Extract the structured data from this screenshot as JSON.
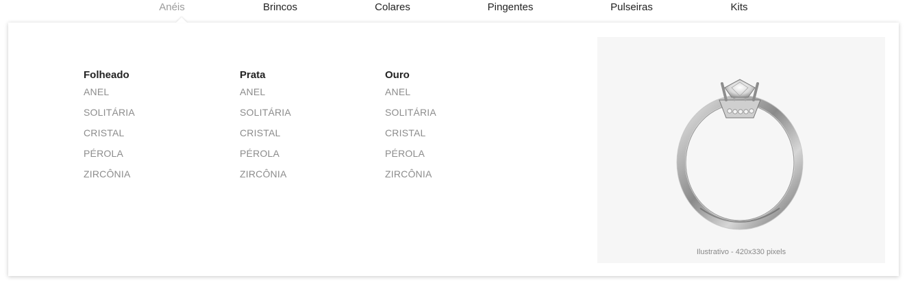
{
  "nav": {
    "items": [
      {
        "label": "Anéis",
        "active": true
      },
      {
        "label": "Brincos",
        "active": false
      },
      {
        "label": "Colares",
        "active": false
      },
      {
        "label": "Pingentes",
        "active": false
      },
      {
        "label": "Pulseiras",
        "active": false
      },
      {
        "label": "Kits",
        "active": false
      }
    ]
  },
  "menu": {
    "columns": [
      {
        "heading": "Folheado",
        "links": [
          "ANEL",
          "SOLITÁRIA",
          "CRISTAL",
          "PÉROLA",
          "ZIRCÔNIA"
        ]
      },
      {
        "heading": "Prata",
        "links": [
          "ANEL",
          "SOLITÁRIA",
          "CRISTAL",
          "PÉROLA",
          "ZIRCÔNIA"
        ]
      },
      {
        "heading": "Ouro",
        "links": [
          "ANEL",
          "SOLITÁRIA",
          "CRISTAL",
          "PÉROLA",
          "ZIRCÔNIA"
        ]
      }
    ]
  },
  "promo": {
    "caption": "Ilustrativo - 420x330 pixels",
    "image": "ring-image"
  },
  "colors": {
    "active_nav": "#9a9a9a",
    "text": "#222222",
    "link": "#8c8c8c",
    "promo_bg": "#f6f6f6"
  }
}
